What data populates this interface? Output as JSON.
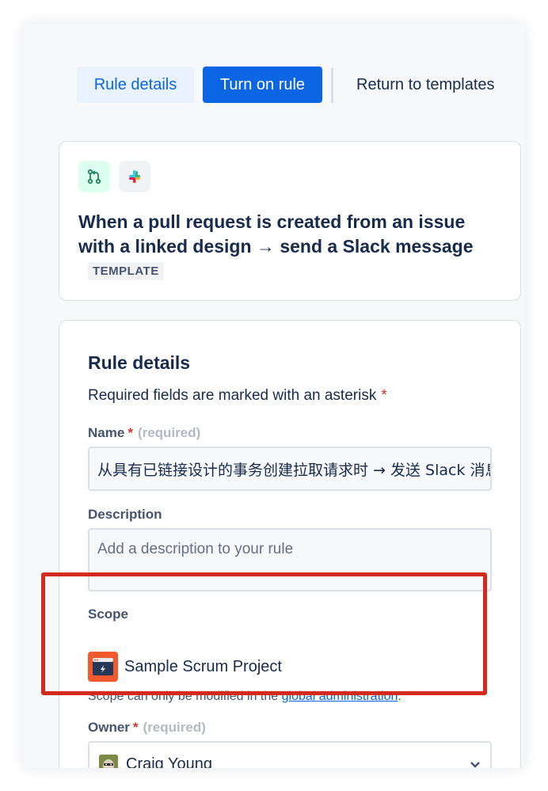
{
  "toolbar": {
    "rule_details_label": "Rule details",
    "turn_on_label": "Turn on rule",
    "return_label": "Return to templates"
  },
  "template": {
    "icons": [
      "git-pull-request-icon",
      "slack-icon"
    ],
    "title": "When a pull request is created from an issue with a linked design → send a Slack message",
    "badge": "TEMPLATE"
  },
  "details": {
    "title": "Rule details",
    "required_note": "Required fields are marked with an asterisk",
    "asterisk": "*",
    "name_label": "Name",
    "name_hint": "(required)",
    "name_value": "从具有已链接设计的事务创建拉取请求时 → 发送 Slack 消息",
    "description_label": "Description",
    "description_placeholder": "Add a description to your rule",
    "scope_label": "Scope",
    "scope_project": "Sample Scrum Project",
    "scope_note_prefix": "Scope can only be modified in the ",
    "scope_note_link": "global administration",
    "scope_note_suffix": ".",
    "owner_label": "Owner",
    "owner_hint": "(required)",
    "owner_value": "Craig Young"
  },
  "colors": {
    "primary": "#0c66e4",
    "highlight": "#d42a1e",
    "required": "#c9372c"
  }
}
